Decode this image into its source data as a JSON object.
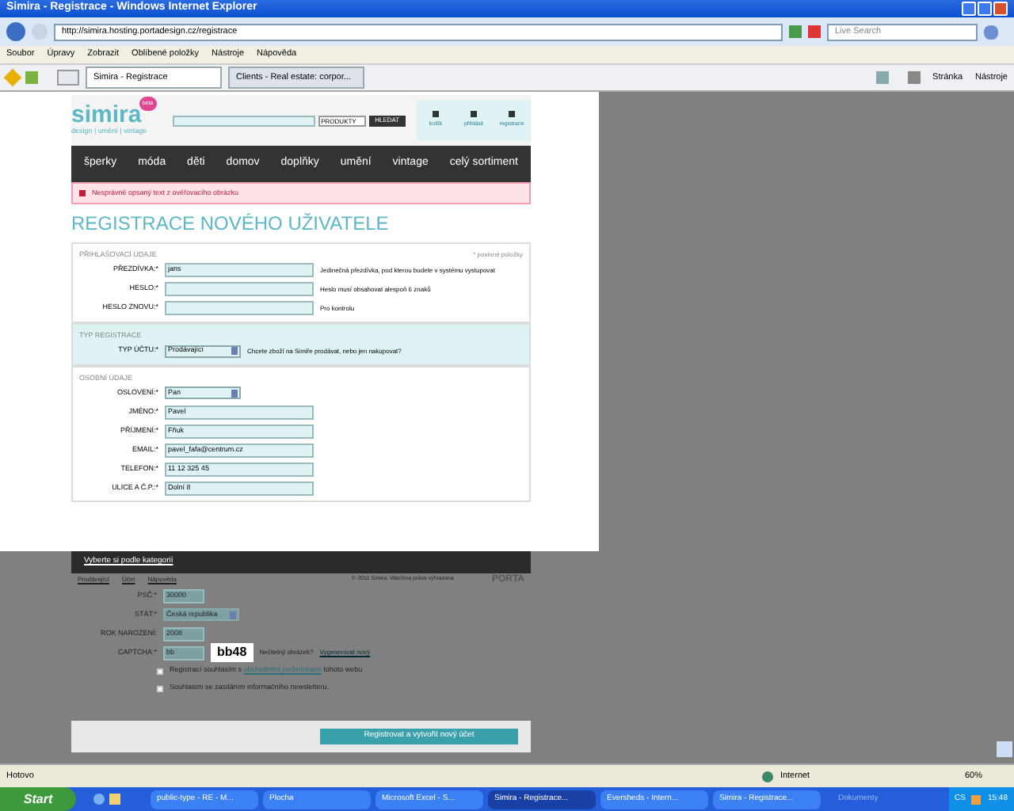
{
  "window": {
    "title": "Simira - Registrace - Windows Internet Explorer"
  },
  "address_bar": {
    "url": "http://simira.hosting.portadesign.cz/registrace",
    "search_placeholder": "Live Search"
  },
  "menu": [
    "Soubor",
    "Úpravy",
    "Zobrazit",
    "Oblíbené položky",
    "Nástroje",
    "Nápověda"
  ],
  "tabs": [
    {
      "label": "Simira - Registrace",
      "selected": true
    },
    {
      "label": "Clients - Real estate: corpor...",
      "selected": false
    }
  ],
  "command_bar": [
    "Stránka",
    "Nástroje"
  ],
  "site": {
    "logo": "simira",
    "logo_sub": "design | umění | vintage",
    "badge": "beta",
    "search_select": "PRODUKTY",
    "search_button": "HLEDAT",
    "header_links": [
      "košík",
      "přihlásit",
      "registrace"
    ],
    "nav": [
      "šperky",
      "móda",
      "děti",
      "domov",
      "doplňky",
      "umění",
      "vintage",
      "celý sortiment"
    ],
    "error": "Nesprávně opsaný text z ověřovacího obrázku",
    "heading": "REGISTRACE NOVÉHO UŽIVATELE",
    "sections": [
      {
        "title": "PŘIHLAŠOVACÍ ÚDAJE",
        "note": "* povinné položky",
        "shaded": false,
        "fields": [
          {
            "kind": "input",
            "label": "PŘEZDÍVKA:*",
            "value": "jans",
            "hint": "Jedinečná přezdívka, pod kterou budete v systému vystupovat"
          },
          {
            "kind": "input",
            "label": "HESLO:*",
            "hint": "Heslo musí obsahovat alespoň 6 znaků"
          },
          {
            "kind": "input",
            "label": "HESLO ZNOVU:*",
            "hint": "Pro kontrolu"
          }
        ]
      },
      {
        "title": "TYP REGISTRACE",
        "shaded": true,
        "fields": [
          {
            "kind": "select",
            "label": "TYP ÚČTU:*",
            "value": "Prodávající",
            "hint": "Chcete zboží na Simiře prodávat, nebo jen nakupovat?"
          }
        ]
      },
      {
        "title": "OSOBNÍ ÚDAJE",
        "shaded": false,
        "fields": [
          {
            "kind": "select",
            "label": "OSLOVENÍ:*",
            "value": "Pan"
          },
          {
            "kind": "input",
            "label": "JMÉNO:*",
            "value": "Pavel"
          },
          {
            "kind": "input",
            "label": "PŘÍJMENÍ:*",
            "value": "Fňuk"
          },
          {
            "kind": "input",
            "label": "EMAIL:*",
            "value": "pavel_fafa@centrum.cz"
          },
          {
            "kind": "input",
            "label": "TELEFON:*",
            "value": "11 12 325 45"
          },
          {
            "kind": "input",
            "label": "ULICE A Č.P.:*",
            "value": "Dolní 8"
          }
        ]
      }
    ]
  },
  "footer": {
    "category_link": "Vyberte si podle kategorií",
    "links": [
      "Prodávající",
      "Účet",
      "Nápověda"
    ],
    "copyright": "© 2011 Simira. Všechna práva vyhrazena",
    "brand": "PORTA"
  },
  "lower_fields": [
    {
      "kind": "input",
      "label": "PSČ:*",
      "value": "30000"
    },
    {
      "kind": "select",
      "label": "STÁT:*",
      "value": "Česká republika"
    },
    {
      "kind": "input",
      "label": "ROK NAROZENÍ:",
      "value": "2008"
    },
    {
      "kind": "captcha",
      "label": "CAPTCHA:*",
      "value": "bb",
      "image_text": "bb48",
      "hint": "Nečitelný obrázek?",
      "link": "Vygenerovat nový"
    }
  ],
  "agreements": [
    {
      "text": "Registrací souhlasím s",
      "link": "obchodními podmínkami",
      "after": "tohoto webu",
      "checked": false
    },
    {
      "text": "Souhlasím se zasíláním informačního newsletteru.",
      "checked": false
    }
  ],
  "submit": "Registrovat a vytvořit nový účet",
  "status_bar": {
    "text": "Hotovo",
    "zone": "Internet",
    "zoom": "60%"
  },
  "taskbar": {
    "start": "Start",
    "buttons": [
      {
        "label": "public-type - RE - M...",
        "selected": false
      },
      {
        "label": "Plocha",
        "selected": false
      },
      {
        "label": "Microsoft Excel - S...",
        "selected": false
      },
      {
        "label": "Simira - Registrace...",
        "selected": true
      },
      {
        "label": "Eversheds - Intern...",
        "selected": false
      },
      {
        "label": "Simira - Registrace...",
        "selected": false
      }
    ],
    "toolbar": "Dokumenty",
    "lang": "CS",
    "clock": "15:48"
  }
}
